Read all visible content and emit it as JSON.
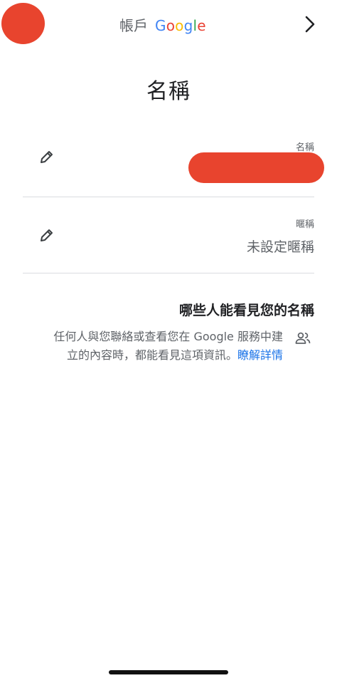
{
  "header": {
    "account_word": "帳戶",
    "google_letters": [
      {
        "ch": "G",
        "color": "#4285f4"
      },
      {
        "ch": "o",
        "color": "#ea4335"
      },
      {
        "ch": "o",
        "color": "#fbbc05"
      },
      {
        "ch": "g",
        "color": "#4285f4"
      },
      {
        "ch": "l",
        "color": "#34a853"
      },
      {
        "ch": "e",
        "color": "#ea4335"
      }
    ]
  },
  "page": {
    "title": "名稱"
  },
  "fields": {
    "name": {
      "label": "名稱",
      "value": ""
    },
    "nickname": {
      "label": "暱稱",
      "value": "未設定暱稱"
    }
  },
  "visibility": {
    "heading": "哪些人能看見您的名稱",
    "line1": "任何人與您聯絡或查看您在 Google 服務中建",
    "line2": "立的內容時，都能看見這項資訊。",
    "link": "瞭解詳情"
  },
  "colors": {
    "accent": "#1a73e8",
    "redaction": "#e8442e",
    "divider": "#dadce0"
  },
  "icons": {
    "back": "chevron-right-icon",
    "edit": "pencil-icon",
    "people": "people-icon"
  }
}
